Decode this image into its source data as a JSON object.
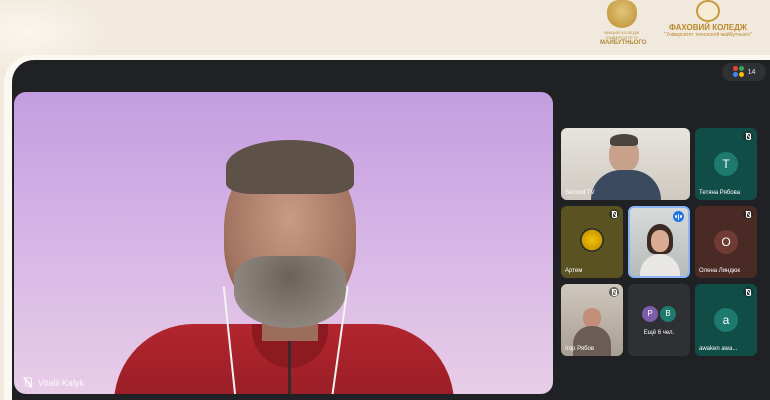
{
  "branding": {
    "logo1_caption_small": "ВИЩИЙ КОЛЕДЖ УНІВЕРСИТЕТУ",
    "logo1_caption": "МАЙБУТНЬОГО",
    "logo2_title": "ФАХОВИЙ КОЛЕДЖ",
    "logo2_subtitle": "\"Університет технологій майбутнього\""
  },
  "meeting": {
    "participant_count": "14",
    "main_speaker": {
      "name": "Vitalii Kalyk",
      "mic": "muted"
    },
    "tiles": [
      {
        "name": "Second TV",
        "type": "video",
        "mic": "on"
      },
      {
        "name": "Тетяна Рябова",
        "type": "avatar",
        "initial": "T",
        "avatar_color": "#1e7a6f",
        "bg": "#114d47",
        "mic": "muted"
      },
      {
        "name": "Артем",
        "type": "image",
        "mic": "muted",
        "bg": "#5a5321"
      },
      {
        "name": "",
        "type": "video",
        "mic": "speaking"
      },
      {
        "name": "Олена Линдюк",
        "type": "avatar",
        "initial": "O",
        "avatar_color": "#6f3b32",
        "bg": "#4a2a25",
        "mic": "muted"
      },
      {
        "name": "Ігор Рябов",
        "type": "video",
        "mic": "muted"
      },
      {
        "name": "Ещё 6 чел.",
        "type": "group",
        "initials": [
          "P",
          "B"
        ],
        "avatar_colors": [
          "#7b5ea7",
          "#1f7a70"
        ],
        "bg": "#2f3034"
      },
      {
        "name": "awaken awa...",
        "type": "avatar",
        "initial": "a",
        "avatar_color": "#1e7a6f",
        "bg": "#114d47",
        "mic": "muted"
      }
    ]
  }
}
